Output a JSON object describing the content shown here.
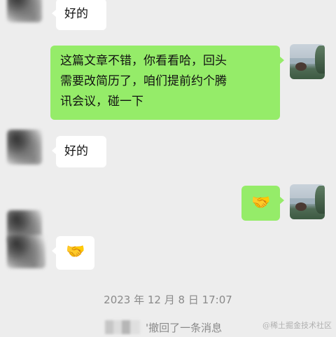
{
  "messages": [
    {
      "side": "left",
      "type": "text",
      "text": "好的"
    },
    {
      "side": "right",
      "type": "text",
      "lines": [
        "这篇文章不错，你看看哈，回头",
        "需要改简历了，咱们提前约个腾",
        "讯会议，碰一下"
      ]
    },
    {
      "side": "left",
      "type": "text",
      "text": "好的"
    },
    {
      "side": "right",
      "type": "emoji",
      "text": "🤝"
    },
    {
      "side": "left",
      "type": "emoji",
      "text": "🤝"
    }
  ],
  "timestamp": "2023 年 12 月 8 日  17:07",
  "recall_notice": "'撤回了一条消息",
  "watermark": "@稀土掘金技术社区",
  "colors": {
    "background": "#ededed",
    "self_bubble": "#95ec69",
    "other_bubble": "#ffffff"
  }
}
